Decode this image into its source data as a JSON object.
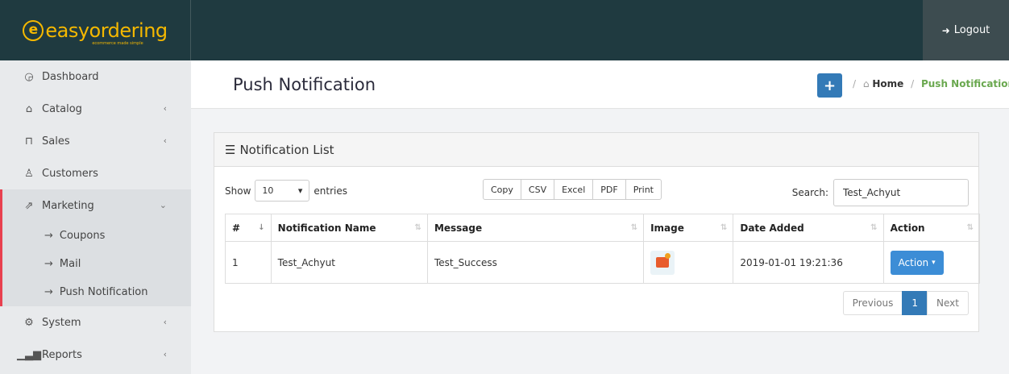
{
  "brand": {
    "name": "easyordering",
    "tagline": "ecommerce made simple"
  },
  "topbar": {
    "logout_label": "Logout"
  },
  "sidebar": {
    "items": [
      {
        "label": "Dashboard",
        "icon": "dashboard-icon"
      },
      {
        "label": "Catalog",
        "icon": "tag-icon"
      },
      {
        "label": "Sales",
        "icon": "cart-icon"
      },
      {
        "label": "Customers",
        "icon": "user-icon"
      },
      {
        "label": "Marketing",
        "icon": "share-icon"
      },
      {
        "label": "System",
        "icon": "gear-icon"
      },
      {
        "label": "Reports",
        "icon": "bar-chart-icon"
      }
    ],
    "marketing_sub": [
      {
        "label": "Coupons"
      },
      {
        "label": "Mail"
      },
      {
        "label": "Push Notification"
      }
    ]
  },
  "header": {
    "title": "Push Notification",
    "breadcrumb": {
      "home": "Home",
      "current": "Push Notification"
    }
  },
  "panel": {
    "title": "Notification List",
    "show_label": "Show",
    "entries_value": "10",
    "entries_label": "entries",
    "export_buttons": [
      "Copy",
      "CSV",
      "Excel",
      "PDF",
      "Print"
    ],
    "search_label": "Search:",
    "search_value": "Test_Achyut"
  },
  "table": {
    "columns": [
      "#",
      "Notification Name",
      "Message",
      "Image",
      "Date Added",
      "Action"
    ],
    "rows": [
      {
        "num": "1",
        "name": "Test_Achyut",
        "message": "Test_Success",
        "date": "2019-01-01 19:21:36",
        "action": "Action"
      }
    ]
  },
  "pagination": {
    "previous": "Previous",
    "current": "1",
    "next": "Next"
  },
  "colors": {
    "topbar": "#1f3a40",
    "brand": "#f5b800",
    "primary": "#337ab7",
    "accent": "#e8404f",
    "breadcrumb_current": "#6aa84f"
  }
}
